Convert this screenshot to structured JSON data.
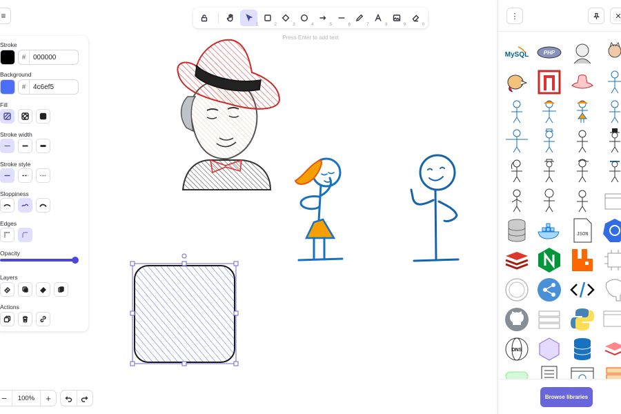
{
  "toolbar": {
    "tools": [
      {
        "name": "lock",
        "num": ""
      },
      {
        "name": "hand",
        "num": ""
      },
      {
        "name": "selection",
        "num": "1"
      },
      {
        "name": "rectangle",
        "num": "2"
      },
      {
        "name": "diamond",
        "num": "3"
      },
      {
        "name": "ellipse",
        "num": "4"
      },
      {
        "name": "arrow",
        "num": "5"
      },
      {
        "name": "line",
        "num": "6"
      },
      {
        "name": "draw",
        "num": "7"
      },
      {
        "name": "text",
        "num": "8"
      },
      {
        "name": "image",
        "num": "9"
      },
      {
        "name": "eraser",
        "num": "0"
      }
    ],
    "active_tool": "selection"
  },
  "canvas_hint": "Press Enter to add text",
  "properties": {
    "stroke_label": "Stroke",
    "stroke_hash": "#",
    "stroke_hex": "000000",
    "stroke_color": "#000000",
    "background_label": "Background",
    "background_hash": "#",
    "background_hex": "4c6ef5",
    "background_color": "#4c6ef5",
    "fill_label": "Fill",
    "stroke_width_label": "Stroke width",
    "stroke_style_label": "Stroke style",
    "sloppiness_label": "Sloppiness",
    "edges_label": "Edges",
    "opacity_label": "Opacity",
    "opacity_value": 1.0,
    "layers_label": "Layers",
    "actions_label": "Actions"
  },
  "zoom": {
    "minus": "−",
    "value": "100%",
    "plus": "+"
  },
  "library": {
    "browse_label": "Browse libraries",
    "items": [
      "mysql-logo",
      "php-logo",
      "portrait-sketch",
      "cat-sketch",
      "parrot",
      "red-window-frame",
      "pink-hat",
      "stick-figure-blue",
      "stick-figure-blue",
      "stick-figure-orange-hair",
      "stick-figure-orange-dress",
      "stick-figure-blue",
      "stick-figure-arms-out",
      "stick-figure-hat",
      "stick-figure-black",
      "stick-figure-top-hat",
      "stick-figure-ponytail",
      "stick-figure-hat-black",
      "stick-figure-cap",
      "stick-figure-blue-hat",
      "stick-figure-plain",
      "stick-figure-round",
      "stick-figure-small",
      "box-open",
      "database-gray",
      "docker-logo",
      "json-file",
      "kubernetes-logo",
      "redis-logo",
      "nginx-logo",
      "rabbitmq-logo",
      "chip",
      "circle-outline",
      "share-network",
      "code-tag",
      "postgres-elephant",
      "github-logo",
      "server-stack",
      "python-logo",
      "browser-window",
      "dns-globe",
      "purple-hexagon",
      "database-blue",
      "red-layers",
      "green-cylinder",
      "document",
      "browser-globe",
      "orange-stack"
    ]
  }
}
